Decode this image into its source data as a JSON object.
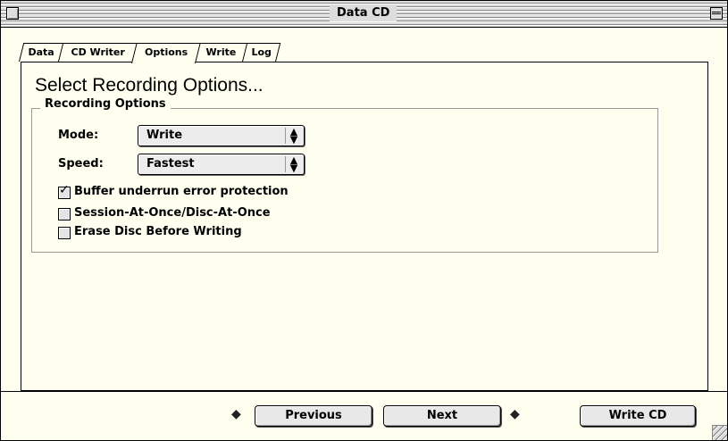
{
  "window": {
    "title": "Data CD"
  },
  "tabs": [
    {
      "label": "Data"
    },
    {
      "label": "CD Writer"
    },
    {
      "label": "Options",
      "active": true
    },
    {
      "label": "Write"
    },
    {
      "label": "Log"
    }
  ],
  "main": {
    "heading": "Select Recording Options...",
    "group_title": "Recording Options",
    "mode_label": "Mode:",
    "mode_value": "Write",
    "speed_label": "Speed:",
    "speed_value": "Fastest",
    "checkboxes": [
      {
        "label": "Buffer underrun error protection",
        "checked": true
      },
      {
        "label": "Session-At-Once/Disc-At-Once",
        "checked": false
      },
      {
        "label": "Erase Disc Before Writing",
        "checked": false
      }
    ]
  },
  "footer": {
    "previous_label": "Previous",
    "next_label": "Next",
    "write_label": "Write CD"
  },
  "icons": {
    "prev_arrow": "left-arrow-icon",
    "next_arrow": "right-arrow-icon",
    "popup_arrows": "up-down-arrows-icon",
    "check": "checkmark-icon"
  }
}
